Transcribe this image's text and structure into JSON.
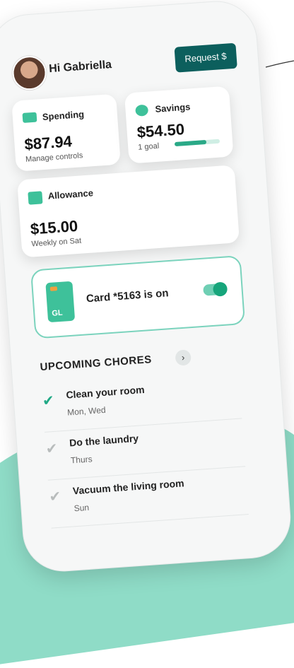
{
  "header": {
    "greeting": "Hi Gabriella",
    "request_button": "Request $"
  },
  "spending": {
    "title": "Spending",
    "amount": "$87.94",
    "subtitle": "Manage controls",
    "icon": "card-icon"
  },
  "savings": {
    "title": "Savings",
    "amount": "$54.50",
    "subtitle": "1 goal",
    "progress": 0.7,
    "icon": "piggy-bank-icon"
  },
  "allowance": {
    "title": "Allowance",
    "amount": "$15.00",
    "subtitle": "Weekly on Sat",
    "icon": "money-icon"
  },
  "card": {
    "label": "Card *5163 is on",
    "brand": "GL",
    "enabled": true
  },
  "chores": {
    "heading": "UPCOMING CHORES",
    "items": [
      {
        "title": "Clean your room",
        "days": "Mon, Wed",
        "done": true
      },
      {
        "title": "Do the laundry",
        "days": "Thurs",
        "done": false
      },
      {
        "title": "Vacuum the living room",
        "days": "Sun",
        "done": false
      }
    ]
  },
  "colors": {
    "accent": "#0c5f5d",
    "green": "#2aa987",
    "mint": "#8fdcc7",
    "check_done": "#20a985",
    "check_pending": "#b8bcbc"
  }
}
